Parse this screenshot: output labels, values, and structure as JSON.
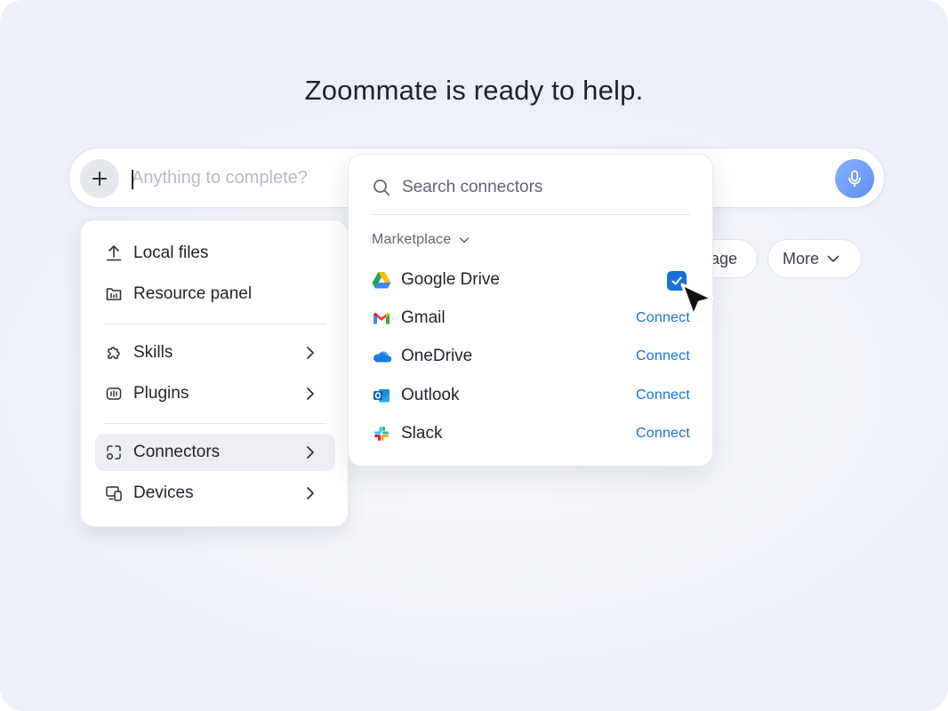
{
  "headline": "Zoommate is ready to help.",
  "chatbar": {
    "placeholder": "Anything to complete?"
  },
  "chips": {
    "page_label": "age",
    "more_label": "More"
  },
  "menu": {
    "items": [
      {
        "label": "Local files",
        "icon": "upload-icon"
      },
      {
        "label": "Resource panel",
        "icon": "folder-icon"
      },
      {
        "label": "Skills",
        "icon": "puzzle-icon"
      },
      {
        "label": "Plugins",
        "icon": "plugin-icon"
      },
      {
        "label": "Connectors",
        "icon": "connectors-icon",
        "active": true
      },
      {
        "label": "Devices",
        "icon": "devices-icon"
      }
    ]
  },
  "connectors_panel": {
    "search_placeholder": "Search connectors",
    "section_label": "Marketplace",
    "items": [
      {
        "name": "Google Drive",
        "logo": "google-drive-logo",
        "action": "",
        "checked": true
      },
      {
        "name": "Gmail",
        "logo": "gmail-logo",
        "action": "Connect"
      },
      {
        "name": "OneDrive",
        "logo": "onedrive-logo",
        "action": "Connect"
      },
      {
        "name": "Outlook",
        "logo": "outlook-logo",
        "action": "Connect"
      },
      {
        "name": "Slack",
        "logo": "slack-logo",
        "action": "Connect"
      }
    ]
  },
  "colors": {
    "accent": "#1a6fd6",
    "mic_gradient_start": "#8bb2fb",
    "mic_gradient_end": "#5d8df2"
  }
}
